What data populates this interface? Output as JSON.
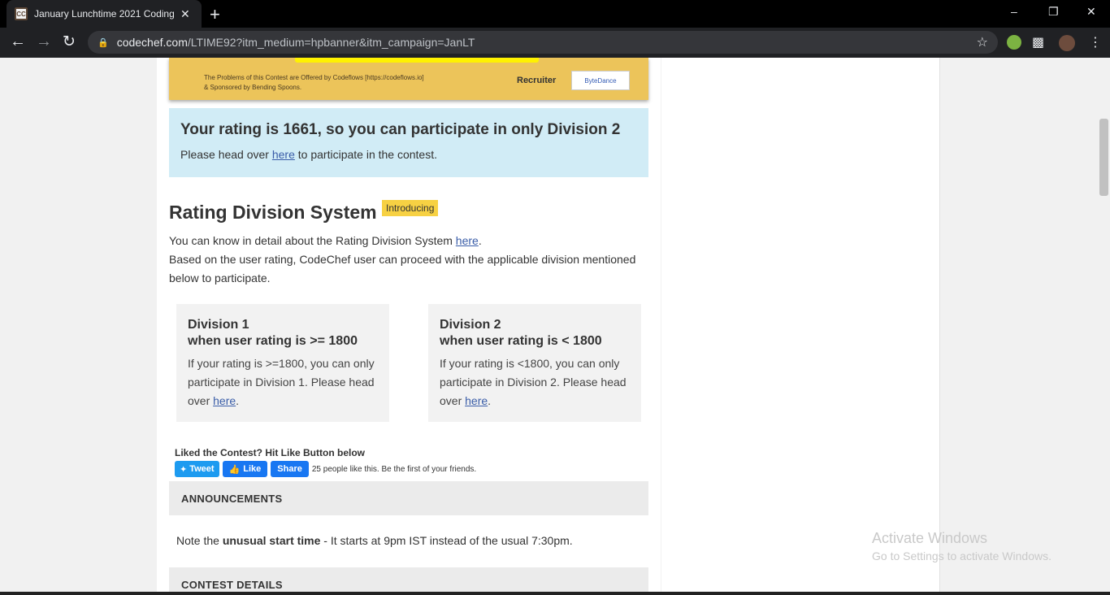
{
  "browser": {
    "tab_favicon": "CC",
    "tab_title": "January Lunchtime 2021 Coding",
    "tab_close": "✕",
    "new_tab": "+",
    "url_host": "codechef.com",
    "url_path": "/LTIME92?itm_medium=hpbanner&itm_campaign=JanLT",
    "window_controls": {
      "minimize": "–",
      "restore": "❐",
      "close": "✕"
    }
  },
  "banner": {
    "credits_line1": "The Problems of this Contest are Offered by Codeflows [https://codeflows.io]",
    "credits_line2": "& Sponsored by Bending Spoons.",
    "recruiter_label": "Recruiter",
    "sponsor_logo": "ByteDance"
  },
  "rating_notice": {
    "heading": "Your rating is 1661, so you can participate in only Division 2",
    "text_before": "Please head over ",
    "link": "here",
    "text_after": " to participate in the contest."
  },
  "rating_division": {
    "title": "Rating Division System",
    "badge": "Introducing",
    "line1_before": "You can know in detail about the Rating Division System ",
    "line1_link": "here",
    "line1_after": ".",
    "line2": "Based on the user rating, CodeChef user can proceed with the applicable division mentioned below to participate."
  },
  "divisions": [
    {
      "title": "Division 1",
      "subtitle": "when user rating is >= 1800",
      "text": "If your rating is >=1800, you can only participate in Division 1. Please head over ",
      "link": "here",
      "end": "."
    },
    {
      "title": "Division 2",
      "subtitle": "when user rating is < 1800",
      "text": "If your rating is <1800, you can only participate in Division 2. Please head over ",
      "link": "here",
      "end": "."
    }
  ],
  "social": {
    "liked_text": "Liked the Contest? Hit Like Button below",
    "tweet": "Tweet",
    "like": "Like",
    "share": "Share",
    "fb_count": "25 people like this. Be the first of your friends."
  },
  "sections": {
    "announcements": "ANNOUNCEMENTS",
    "contest_details": "CONTEST DETAILS"
  },
  "announcement": {
    "before": "Note the ",
    "bold": "unusual start time",
    "after": " - It starts at 9pm IST instead of the usual 7:30pm."
  },
  "watermark": {
    "line1": "Activate Windows",
    "line2": "Go to Settings to activate Windows."
  }
}
